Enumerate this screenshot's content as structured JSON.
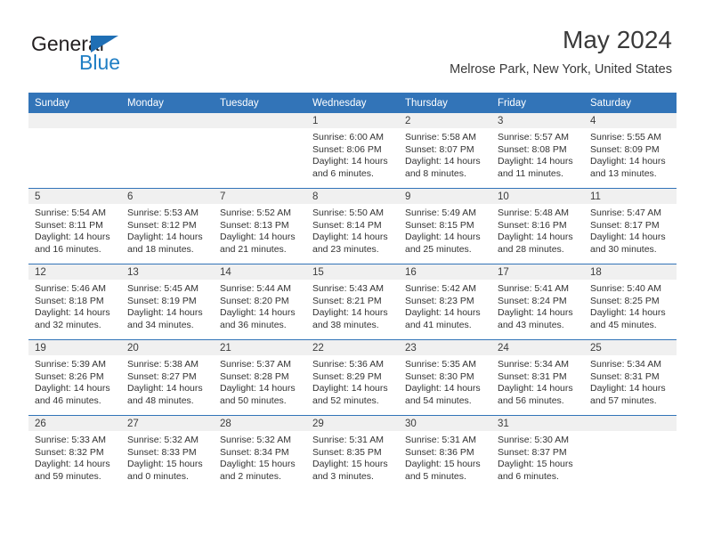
{
  "logo": {
    "word_one": "General",
    "word_two": "Blue",
    "accent_color": "#1f7ec4"
  },
  "header": {
    "month_title": "May 2024",
    "location": "Melrose Park, New York, United States",
    "header_bg": "#3274b8"
  },
  "calendar": {
    "weekday_headers": [
      "Sunday",
      "Monday",
      "Tuesday",
      "Wednesday",
      "Thursday",
      "Friday",
      "Saturday"
    ],
    "weeks": [
      [
        {
          "day": "",
          "sunrise": "",
          "sunset": "",
          "daylight_line1": "",
          "daylight_line2": ""
        },
        {
          "day": "",
          "sunrise": "",
          "sunset": "",
          "daylight_line1": "",
          "daylight_line2": ""
        },
        {
          "day": "",
          "sunrise": "",
          "sunset": "",
          "daylight_line1": "",
          "daylight_line2": ""
        },
        {
          "day": "1",
          "sunrise": "Sunrise: 6:00 AM",
          "sunset": "Sunset: 8:06 PM",
          "daylight_line1": "Daylight: 14 hours",
          "daylight_line2": "and 6 minutes."
        },
        {
          "day": "2",
          "sunrise": "Sunrise: 5:58 AM",
          "sunset": "Sunset: 8:07 PM",
          "daylight_line1": "Daylight: 14 hours",
          "daylight_line2": "and 8 minutes."
        },
        {
          "day": "3",
          "sunrise": "Sunrise: 5:57 AM",
          "sunset": "Sunset: 8:08 PM",
          "daylight_line1": "Daylight: 14 hours",
          "daylight_line2": "and 11 minutes."
        },
        {
          "day": "4",
          "sunrise": "Sunrise: 5:55 AM",
          "sunset": "Sunset: 8:09 PM",
          "daylight_line1": "Daylight: 14 hours",
          "daylight_line2": "and 13 minutes."
        }
      ],
      [
        {
          "day": "5",
          "sunrise": "Sunrise: 5:54 AM",
          "sunset": "Sunset: 8:11 PM",
          "daylight_line1": "Daylight: 14 hours",
          "daylight_line2": "and 16 minutes."
        },
        {
          "day": "6",
          "sunrise": "Sunrise: 5:53 AM",
          "sunset": "Sunset: 8:12 PM",
          "daylight_line1": "Daylight: 14 hours",
          "daylight_line2": "and 18 minutes."
        },
        {
          "day": "7",
          "sunrise": "Sunrise: 5:52 AM",
          "sunset": "Sunset: 8:13 PM",
          "daylight_line1": "Daylight: 14 hours",
          "daylight_line2": "and 21 minutes."
        },
        {
          "day": "8",
          "sunrise": "Sunrise: 5:50 AM",
          "sunset": "Sunset: 8:14 PM",
          "daylight_line1": "Daylight: 14 hours",
          "daylight_line2": "and 23 minutes."
        },
        {
          "day": "9",
          "sunrise": "Sunrise: 5:49 AM",
          "sunset": "Sunset: 8:15 PM",
          "daylight_line1": "Daylight: 14 hours",
          "daylight_line2": "and 25 minutes."
        },
        {
          "day": "10",
          "sunrise": "Sunrise: 5:48 AM",
          "sunset": "Sunset: 8:16 PM",
          "daylight_line1": "Daylight: 14 hours",
          "daylight_line2": "and 28 minutes."
        },
        {
          "day": "11",
          "sunrise": "Sunrise: 5:47 AM",
          "sunset": "Sunset: 8:17 PM",
          "daylight_line1": "Daylight: 14 hours",
          "daylight_line2": "and 30 minutes."
        }
      ],
      [
        {
          "day": "12",
          "sunrise": "Sunrise: 5:46 AM",
          "sunset": "Sunset: 8:18 PM",
          "daylight_line1": "Daylight: 14 hours",
          "daylight_line2": "and 32 minutes."
        },
        {
          "day": "13",
          "sunrise": "Sunrise: 5:45 AM",
          "sunset": "Sunset: 8:19 PM",
          "daylight_line1": "Daylight: 14 hours",
          "daylight_line2": "and 34 minutes."
        },
        {
          "day": "14",
          "sunrise": "Sunrise: 5:44 AM",
          "sunset": "Sunset: 8:20 PM",
          "daylight_line1": "Daylight: 14 hours",
          "daylight_line2": "and 36 minutes."
        },
        {
          "day": "15",
          "sunrise": "Sunrise: 5:43 AM",
          "sunset": "Sunset: 8:21 PM",
          "daylight_line1": "Daylight: 14 hours",
          "daylight_line2": "and 38 minutes."
        },
        {
          "day": "16",
          "sunrise": "Sunrise: 5:42 AM",
          "sunset": "Sunset: 8:23 PM",
          "daylight_line1": "Daylight: 14 hours",
          "daylight_line2": "and 41 minutes."
        },
        {
          "day": "17",
          "sunrise": "Sunrise: 5:41 AM",
          "sunset": "Sunset: 8:24 PM",
          "daylight_line1": "Daylight: 14 hours",
          "daylight_line2": "and 43 minutes."
        },
        {
          "day": "18",
          "sunrise": "Sunrise: 5:40 AM",
          "sunset": "Sunset: 8:25 PM",
          "daylight_line1": "Daylight: 14 hours",
          "daylight_line2": "and 45 minutes."
        }
      ],
      [
        {
          "day": "19",
          "sunrise": "Sunrise: 5:39 AM",
          "sunset": "Sunset: 8:26 PM",
          "daylight_line1": "Daylight: 14 hours",
          "daylight_line2": "and 46 minutes."
        },
        {
          "day": "20",
          "sunrise": "Sunrise: 5:38 AM",
          "sunset": "Sunset: 8:27 PM",
          "daylight_line1": "Daylight: 14 hours",
          "daylight_line2": "and 48 minutes."
        },
        {
          "day": "21",
          "sunrise": "Sunrise: 5:37 AM",
          "sunset": "Sunset: 8:28 PM",
          "daylight_line1": "Daylight: 14 hours",
          "daylight_line2": "and 50 minutes."
        },
        {
          "day": "22",
          "sunrise": "Sunrise: 5:36 AM",
          "sunset": "Sunset: 8:29 PM",
          "daylight_line1": "Daylight: 14 hours",
          "daylight_line2": "and 52 minutes."
        },
        {
          "day": "23",
          "sunrise": "Sunrise: 5:35 AM",
          "sunset": "Sunset: 8:30 PM",
          "daylight_line1": "Daylight: 14 hours",
          "daylight_line2": "and 54 minutes."
        },
        {
          "day": "24",
          "sunrise": "Sunrise: 5:34 AM",
          "sunset": "Sunset: 8:31 PM",
          "daylight_line1": "Daylight: 14 hours",
          "daylight_line2": "and 56 minutes."
        },
        {
          "day": "25",
          "sunrise": "Sunrise: 5:34 AM",
          "sunset": "Sunset: 8:31 PM",
          "daylight_line1": "Daylight: 14 hours",
          "daylight_line2": "and 57 minutes."
        }
      ],
      [
        {
          "day": "26",
          "sunrise": "Sunrise: 5:33 AM",
          "sunset": "Sunset: 8:32 PM",
          "daylight_line1": "Daylight: 14 hours",
          "daylight_line2": "and 59 minutes."
        },
        {
          "day": "27",
          "sunrise": "Sunrise: 5:32 AM",
          "sunset": "Sunset: 8:33 PM",
          "daylight_line1": "Daylight: 15 hours",
          "daylight_line2": "and 0 minutes."
        },
        {
          "day": "28",
          "sunrise": "Sunrise: 5:32 AM",
          "sunset": "Sunset: 8:34 PM",
          "daylight_line1": "Daylight: 15 hours",
          "daylight_line2": "and 2 minutes."
        },
        {
          "day": "29",
          "sunrise": "Sunrise: 5:31 AM",
          "sunset": "Sunset: 8:35 PM",
          "daylight_line1": "Daylight: 15 hours",
          "daylight_line2": "and 3 minutes."
        },
        {
          "day": "30",
          "sunrise": "Sunrise: 5:31 AM",
          "sunset": "Sunset: 8:36 PM",
          "daylight_line1": "Daylight: 15 hours",
          "daylight_line2": "and 5 minutes."
        },
        {
          "day": "31",
          "sunrise": "Sunrise: 5:30 AM",
          "sunset": "Sunset: 8:37 PM",
          "daylight_line1": "Daylight: 15 hours",
          "daylight_line2": "and 6 minutes."
        },
        {
          "day": "",
          "sunrise": "",
          "sunset": "",
          "daylight_line1": "",
          "daylight_line2": ""
        }
      ]
    ]
  }
}
